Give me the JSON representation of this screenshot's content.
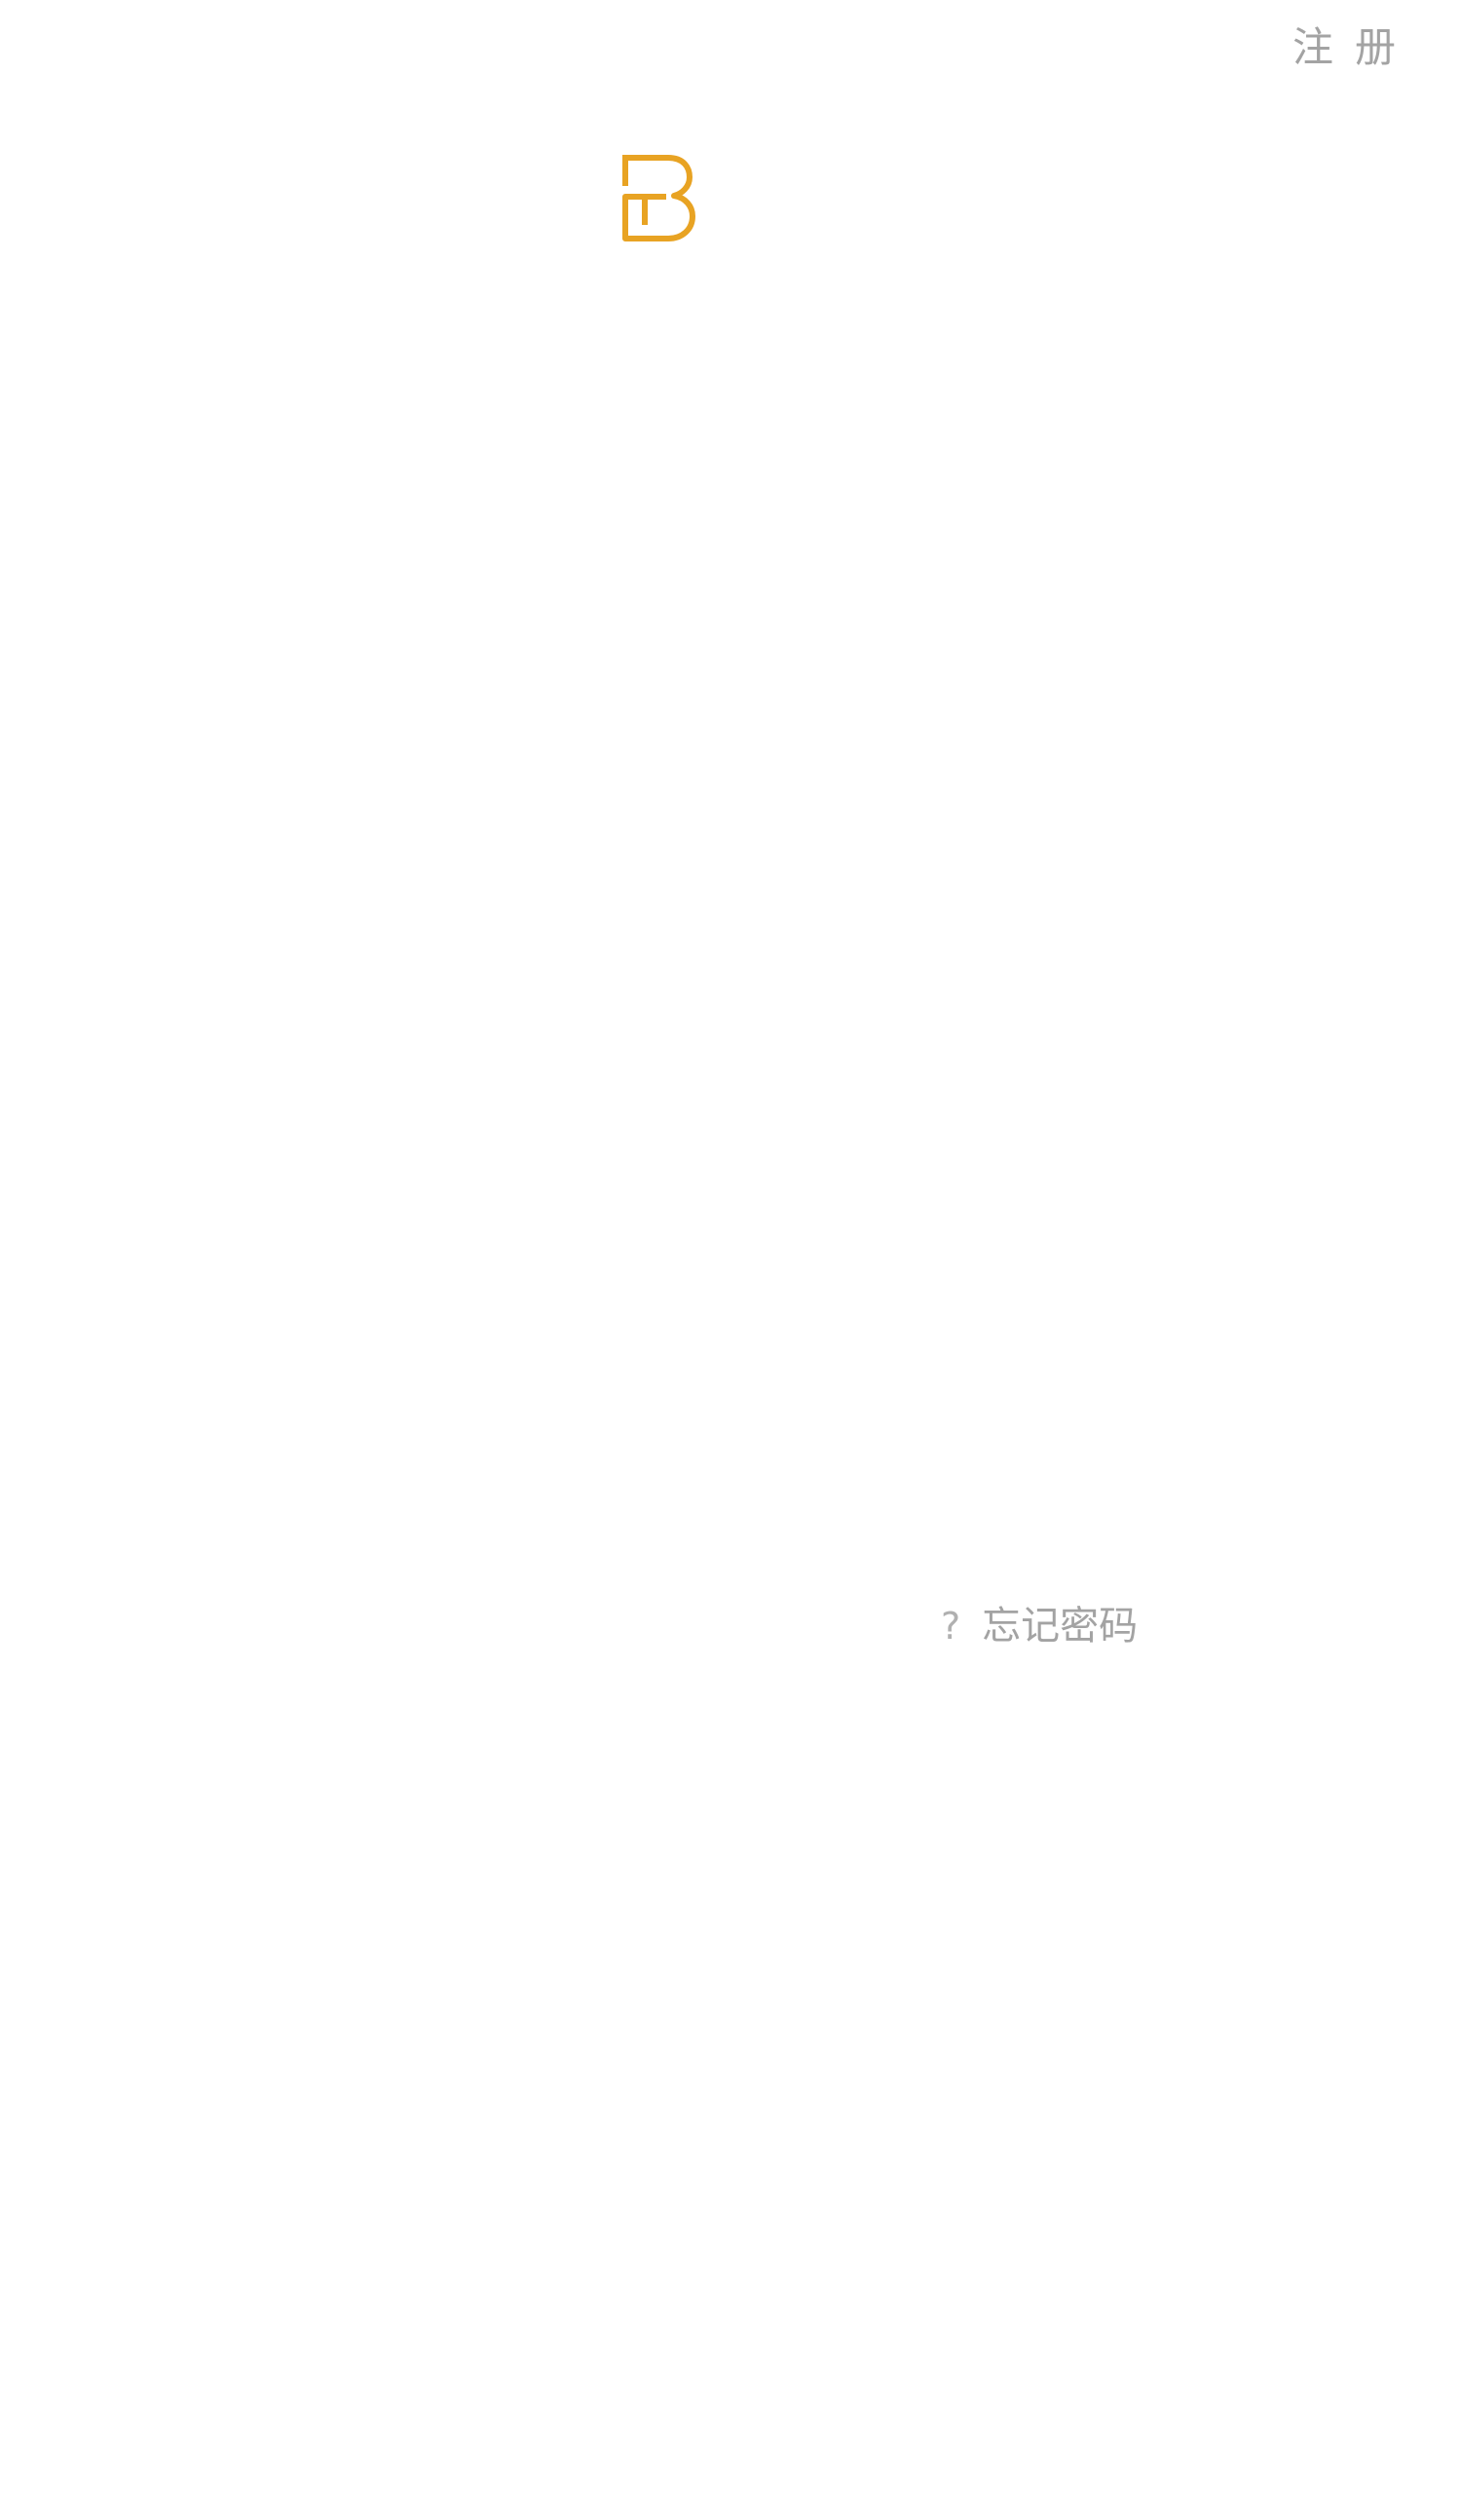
{
  "header": {
    "register_label": "注册"
  },
  "logo": {
    "icon": "b-logo-icon",
    "color": "#E8A323"
  },
  "login": {
    "forgot_password_prefix": "?",
    "forgot_password_label": "忘记密码"
  }
}
